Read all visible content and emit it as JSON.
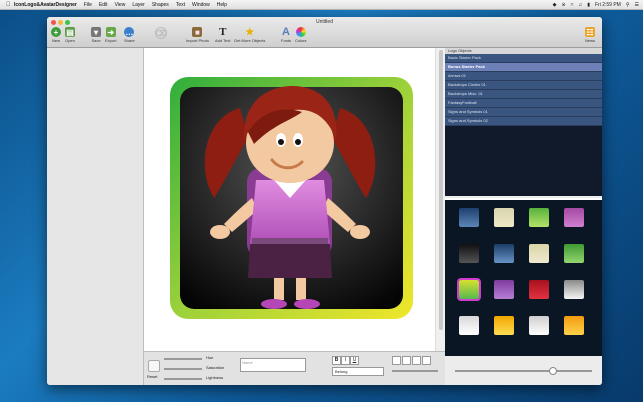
{
  "menubar": {
    "app_name": "IconLogo&AvatarDesigner",
    "items": [
      "File",
      "Edit",
      "View",
      "Layer",
      "Shapes",
      "Text",
      "Window",
      "Help"
    ],
    "clock": "Fri 2:59 PM"
  },
  "window": {
    "title": "Untitled",
    "toolbar": {
      "new": "New",
      "open": "Open",
      "save": "Save",
      "export": "Export",
      "share": "Share",
      "import_photo": "Import Photo",
      "add_text": "Add Text",
      "get_more_objects": "Get More Objects",
      "fonts": "Fonts",
      "colors": "Colors",
      "news": "News"
    }
  },
  "bottom": {
    "hue_label": "Hue",
    "saturation_label": "Saturation",
    "lightness_label": "Lightness",
    "reset_label": "Reset",
    "text_placeholder": "Name",
    "bold": "B",
    "italic": "I",
    "underline": "U",
    "font_select": "Belong"
  },
  "logo_objects": {
    "header": "Logo Objects",
    "items": [
      "Basic Starter Pack",
      "Bonus Starter Pack",
      "Arrows 01",
      "Backdrops Circles 01",
      "Backdrops Misc. 01",
      "FantasyFootball",
      "Signs and Symbols 01",
      "Signs and Symbols 02"
    ],
    "selected_index": 1
  },
  "swatches": {
    "colors": [
      [
        "#1d3f6e",
        "#5c86b8"
      ],
      [
        "#d8d4b0",
        "#efe9c4"
      ],
      [
        "#58b13b",
        "#b3e36a"
      ],
      [
        "#a34aa2",
        "#d07fd0"
      ],
      [
        "#101010",
        "#555555"
      ],
      [
        "#1b3b66",
        "#6893c8"
      ],
      [
        "#d9d4a8",
        "#f0ead0"
      ],
      [
        "#3e9932",
        "#92d66f"
      ],
      [
        "#d6e02e",
        "#55b850"
      ],
      [
        "#7f3c9e",
        "#b87fd6"
      ],
      [
        "#a8101d",
        "#e23341"
      ],
      [
        "#8a8a8a",
        "#f4f4f4"
      ],
      [
        "#d8d8d8",
        "#ffffff"
      ],
      [
        "#f2a700",
        "#ffdd55"
      ],
      [
        "#cfcfcf",
        "#ffffff"
      ],
      [
        "#f29b10",
        "#ffd24a"
      ]
    ],
    "selected_index": 8
  }
}
